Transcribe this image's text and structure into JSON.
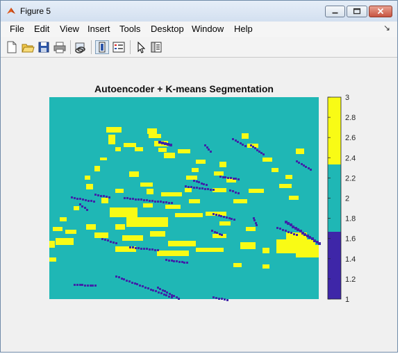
{
  "window": {
    "title": "Figure 5",
    "controls": {
      "minimize": "minimize",
      "maximize": "maximize",
      "close": "close"
    }
  },
  "menu": {
    "items": [
      "File",
      "Edit",
      "View",
      "Insert",
      "Tools",
      "Desktop",
      "Window",
      "Help"
    ],
    "right_glyph": "↘"
  },
  "toolbar": {
    "icons": [
      "new-figure-icon",
      "open-file-icon",
      "save-figure-icon",
      "print-figure-icon",
      "link-plot-icon",
      "insert-colorbar-icon",
      "insert-legend-icon",
      "edit-plot-arrow-icon",
      "property-inspector-icon"
    ]
  },
  "colors": {
    "class_1": "#3e26a8",
    "class_2": "#1fb7b5",
    "class_3": "#f9fb15"
  },
  "chart_data": {
    "type": "heatmap",
    "title": "Autoencoder + K-means Segmentation",
    "xlabel": "",
    "ylabel": "",
    "colorbar": {
      "range": [
        1,
        3
      ],
      "ticks": [
        1,
        1.2,
        1.4,
        1.6,
        1.8,
        2,
        2.2,
        2.4,
        2.6,
        2.8,
        3
      ],
      "tick_labels": [
        "1",
        "1.2",
        "1.4",
        "1.6",
        "1.8",
        "2",
        "2.2",
        "2.4",
        "2.6",
        "2.8",
        "3"
      ],
      "levels": [
        1,
        2,
        3
      ],
      "level_colors": [
        "#3e26a8",
        "#1fb7b5",
        "#f9fb15"
      ]
    },
    "background_class": 2,
    "grid": false,
    "description_of_values": "segmentation label map with 3 classes; majority class 2 (teal), scattered class 3 (yellow) blobs, thin class 1 (dark blue) edges"
  }
}
